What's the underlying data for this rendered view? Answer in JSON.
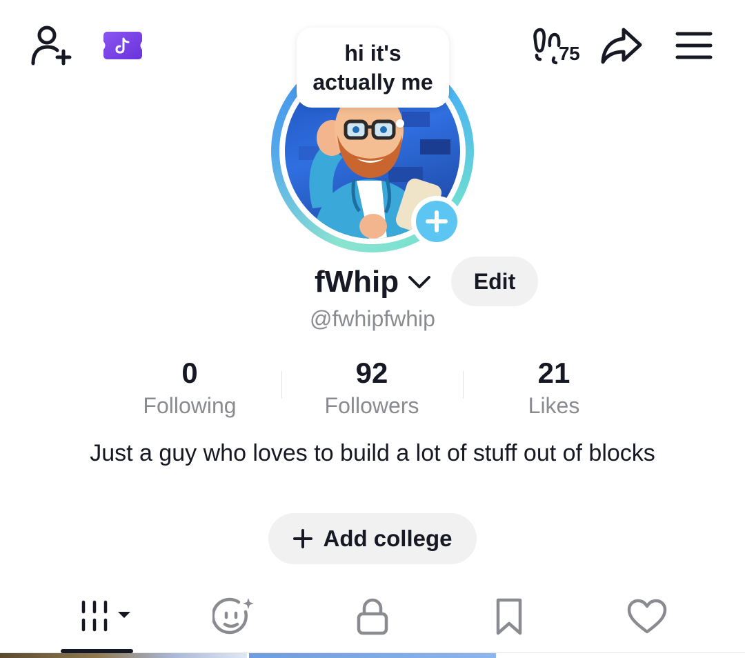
{
  "top_bar": {
    "add_friends_icon": "person-plus-icon",
    "promo_icon": "tiktok-ticket-icon",
    "footprint_icon": "footprints-icon",
    "footprint_count": "75",
    "share_icon": "share-arrow-icon",
    "menu_icon": "hamburger-menu-icon"
  },
  "avatar": {
    "bubble_text": "hi it's\nactually me",
    "add_icon": "plus-icon"
  },
  "profile": {
    "display_name": "fWhip",
    "edit_label": "Edit",
    "username": "@fwhipfwhip",
    "bio": "Just a guy who loves to build a lot of stuff out of blocks"
  },
  "stats": [
    {
      "value": "0",
      "label": "Following"
    },
    {
      "value": "92",
      "label": "Followers"
    },
    {
      "value": "21",
      "label": "Likes"
    }
  ],
  "college_button": {
    "label": "Add college",
    "icon": "plus-icon"
  },
  "tabs": [
    {
      "name": "videos-grid",
      "icon": "grid-bars-icon",
      "active": true
    },
    {
      "name": "ai-self",
      "icon": "sparkle-face-icon",
      "active": false
    },
    {
      "name": "private",
      "icon": "lock-icon",
      "active": false
    },
    {
      "name": "favorites",
      "icon": "bookmark-icon",
      "active": false
    },
    {
      "name": "liked",
      "icon": "heart-icon",
      "active": false
    }
  ],
  "colors": {
    "promo_purple": "#7a45e8",
    "ring_blue": "#4aa3ec",
    "ring_teal": "#7fe2cf",
    "plus_blue": "#5cc5f2",
    "muted_text": "#8a8b91",
    "chip_bg": "#f1f1f2"
  }
}
